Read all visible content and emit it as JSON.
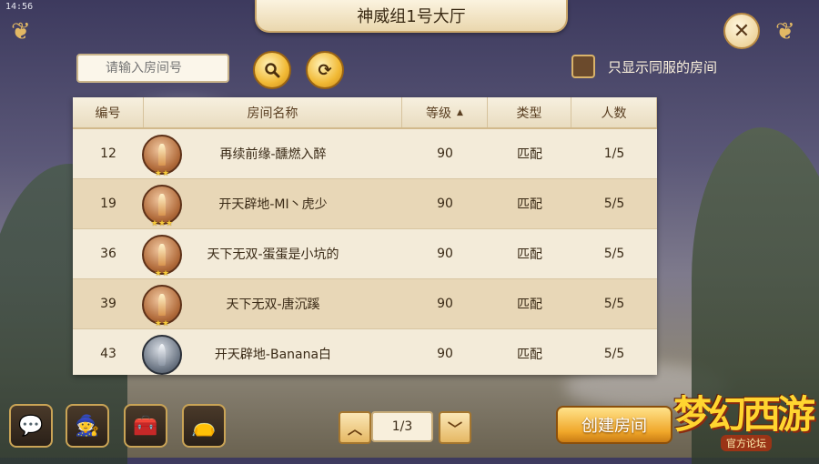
{
  "status_bar": {
    "time": "14:56"
  },
  "header": {
    "title": "神威组1号大厅"
  },
  "search": {
    "placeholder": "请输入房间号"
  },
  "filter": {
    "label": "只显示同服的房间",
    "checked": false
  },
  "table": {
    "columns": [
      "编号",
      "房间名称",
      "等级",
      "类型",
      "人数"
    ],
    "sort_indicator": "▲",
    "rows": [
      {
        "id": "12",
        "name": "再续前缘-醺燃入醉",
        "level": "90",
        "type": "匹配",
        "players": "1/5",
        "badge": "bronze",
        "stars": "★★"
      },
      {
        "id": "19",
        "name": "开天辟地-MI丶虎少",
        "level": "90",
        "type": "匹配",
        "players": "5/5",
        "badge": "bronze",
        "stars": "★★★"
      },
      {
        "id": "36",
        "name": "天下无双-蛋蛋是小坑的",
        "level": "90",
        "type": "匹配",
        "players": "5/5",
        "badge": "bronze",
        "stars": "★★"
      },
      {
        "id": "39",
        "name": "天下无双-唐沉蹊",
        "level": "90",
        "type": "匹配",
        "players": "5/5",
        "badge": "bronze",
        "stars": "★★"
      },
      {
        "id": "43",
        "name": "开天辟地-Banana白",
        "level": "90",
        "type": "匹配",
        "players": "5/5",
        "badge": "silver",
        "stars": ""
      }
    ]
  },
  "pagination": {
    "page": "1/3"
  },
  "actions": {
    "create_room": "创建房间"
  },
  "logo": {
    "main": "梦幻西游",
    "sub": "官方论坛"
  },
  "icons": {
    "search": "search-icon",
    "refresh": "refresh-icon",
    "close": "close-icon",
    "chat": "chat-icon",
    "wizard": "character-icon",
    "chest": "treasure-chest-icon",
    "pouch": "lucky-bag-icon"
  },
  "colors": {
    "accent": "#f0a72a",
    "panel": "#f3ebd9",
    "alt_row": "#e8d7b7"
  }
}
